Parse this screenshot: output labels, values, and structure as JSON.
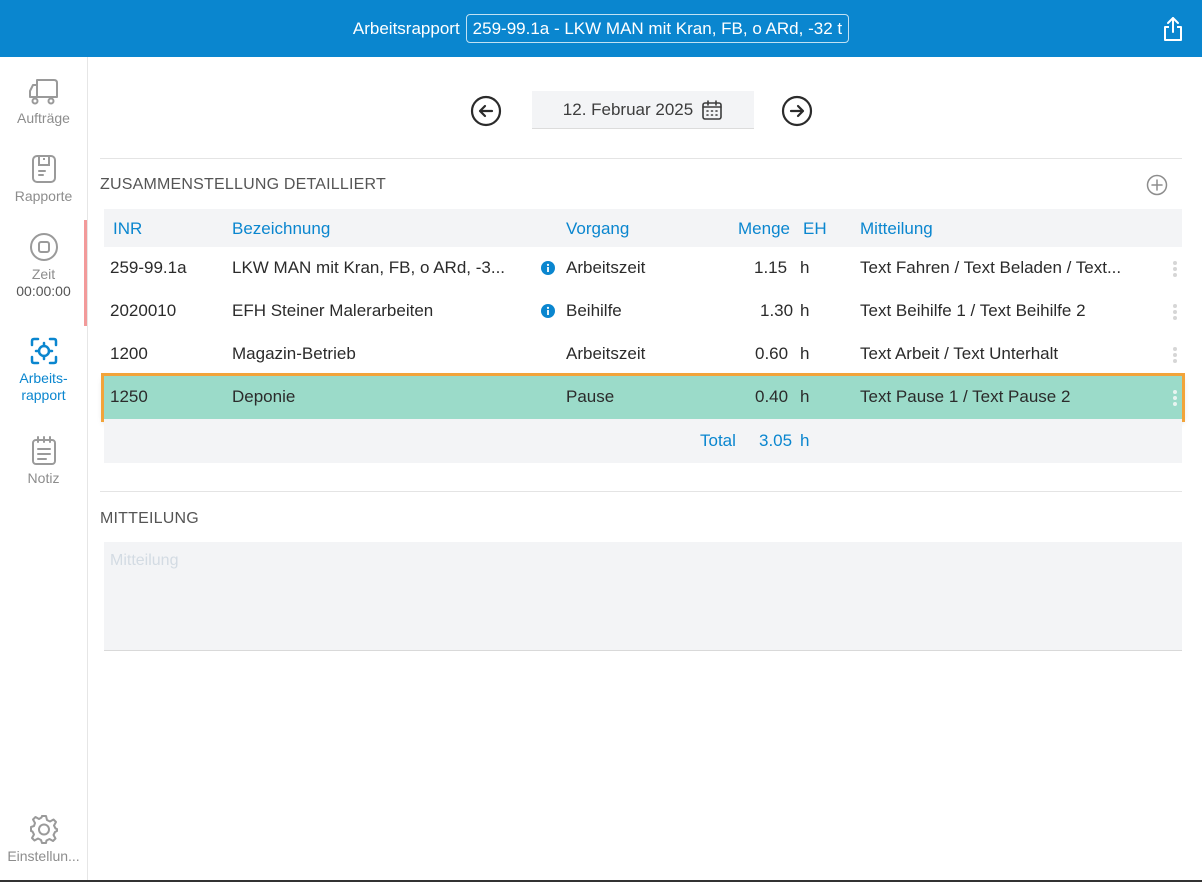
{
  "header": {
    "title": "Arbeitsrapport",
    "selected_order": "259-99.1a - LKW MAN mit Kran, FB, o ARd, -32 t",
    "share_icon": "share-icon"
  },
  "sidebar": {
    "items": [
      {
        "label": "Aufträge",
        "icon": "truck-icon"
      },
      {
        "label": "Rapporte",
        "icon": "report-icon"
      },
      {
        "label": "Zeit",
        "sub": "00:00:00",
        "icon": "stop-icon"
      },
      {
        "label": "Arbeits-",
        "label2": "rapport",
        "icon": "target-icon"
      },
      {
        "label": "Notiz",
        "icon": "notepad-icon"
      }
    ],
    "settings_label": "Einstellun..."
  },
  "date_nav": {
    "date": "12. Februar 2025"
  },
  "summary": {
    "title": "ZUSAMMENSTELLUNG DETAILLIERT",
    "columns": {
      "inr": "INR",
      "bezeichnung": "Bezeichnung",
      "vorgang": "Vorgang",
      "menge": "Menge",
      "eh": "EH",
      "mitteilung": "Mitteilung"
    },
    "rows": [
      {
        "inr": "259-99.1a",
        "bezeichnung": "LKW MAN mit Kran, FB, o ARd, -3...",
        "info": true,
        "vorgang": "Arbeitszeit",
        "menge": "1.15",
        "eh": "h",
        "mitteilung": "Text Fahren / Text Beladen / Text..."
      },
      {
        "inr": "2020010",
        "bezeichnung": "EFH Steiner Malerarbeiten",
        "info": true,
        "vorgang": "Beihilfe",
        "menge": "1.30",
        "eh": "h",
        "mitteilung": "Text Beihilfe 1 / Text Beihilfe 2"
      },
      {
        "inr": "1200",
        "bezeichnung": "Magazin-Betrieb",
        "info": false,
        "vorgang": "Arbeitszeit",
        "menge": "0.60",
        "eh": "h",
        "mitteilung": "Text Arbeit / Text Unterhalt"
      },
      {
        "inr": "1250",
        "bezeichnung": "Deponie",
        "info": false,
        "vorgang": "Pause",
        "menge": "0.40",
        "eh": "h",
        "mitteilung": "Text Pause 1 / Text Pause 2"
      }
    ],
    "total_label": "Total",
    "total_value": "3.05",
    "total_unit": "h"
  },
  "message": {
    "title": "MITTEILUNG",
    "placeholder": "Mitteilung",
    "value": ""
  },
  "colors": {
    "accent": "#0a86cf",
    "selected_row": "#9bdbc9",
    "selection_outline": "#f2a43a"
  }
}
